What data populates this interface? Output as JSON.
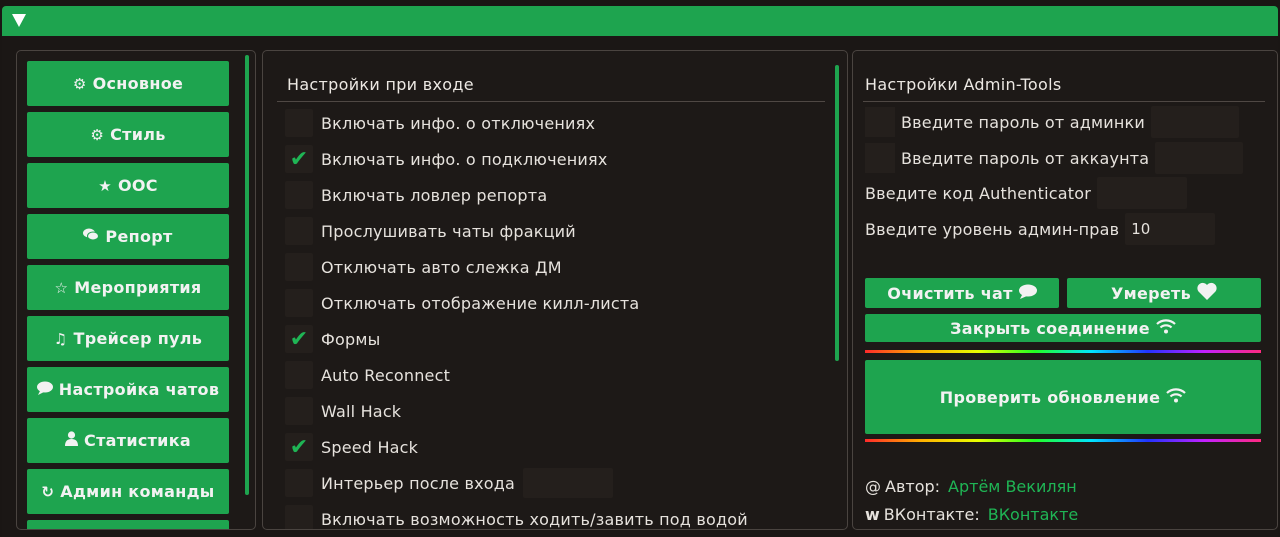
{
  "titlebar": {
    "collapse_icon": "triangle-down-icon"
  },
  "sidebar": {
    "items": [
      {
        "label": "Основное",
        "icon": "gears-icon",
        "glyph": "⚙"
      },
      {
        "label": "Стиль",
        "icon": "gears-icon",
        "glyph": "⚙"
      },
      {
        "label": "OOC",
        "icon": "star-icon",
        "glyph": "★"
      },
      {
        "label": "Репорт",
        "icon": "chat-icon",
        "glyph": "💬"
      },
      {
        "label": "Мероприятия",
        "icon": "star-outline-icon",
        "glyph": "☆"
      },
      {
        "label": "Трейсер пуль",
        "icon": "music-note-icon",
        "glyph": "♫"
      },
      {
        "label": "Настройка чатов",
        "icon": "chat-bubble-icon",
        "glyph": "💬"
      },
      {
        "label": "Статистика",
        "icon": "user-icon",
        "glyph": "👤"
      },
      {
        "label": "Админ команды",
        "icon": "refresh-icon",
        "glyph": "↻"
      }
    ]
  },
  "login_settings": {
    "title": "Настройки при входе",
    "options": [
      {
        "label": "Включать инфо. о отключениях",
        "checked": false
      },
      {
        "label": "Включать инфо. о подключениях",
        "checked": true
      },
      {
        "label": "Включать ловлер репорта",
        "checked": false
      },
      {
        "label": "Прослушивать чаты фракций",
        "checked": false
      },
      {
        "label": "Отключать авто слежка ДМ",
        "checked": false
      },
      {
        "label": "Отключать отображение килл-листа",
        "checked": false
      },
      {
        "label": "Формы",
        "checked": true
      },
      {
        "label": "Auto Reconnect",
        "checked": false
      },
      {
        "label": "Wall Hack",
        "checked": false
      },
      {
        "label": "Speed Hack",
        "checked": true
      },
      {
        "label": "Интерьер после входа",
        "checked": false
      },
      {
        "label": "Включать возможность ходить/завить под водой",
        "checked": false
      }
    ],
    "check_glyph": "✔"
  },
  "admin_tools": {
    "title": "Настройки Admin-Tools",
    "admin_password_label": "Введите пароль от админки",
    "account_password_label": "Введите пароль от аккаунта",
    "authenticator_label": "Введите код Authenticator",
    "admin_level_label": "Введите уровень админ-прав",
    "admin_level_value": "10",
    "clear_chat_label": "Очистить чат",
    "die_label": "Умереть",
    "close_connection_label": "Закрыть соединение",
    "check_update_label": "Проверить обновление",
    "author_label": "Автор:",
    "author_value": "Артём Векилян",
    "vk_label": "ВКонтакте:",
    "vk_value": "ВКонтакте",
    "accent_color": "#1ea44f"
  }
}
